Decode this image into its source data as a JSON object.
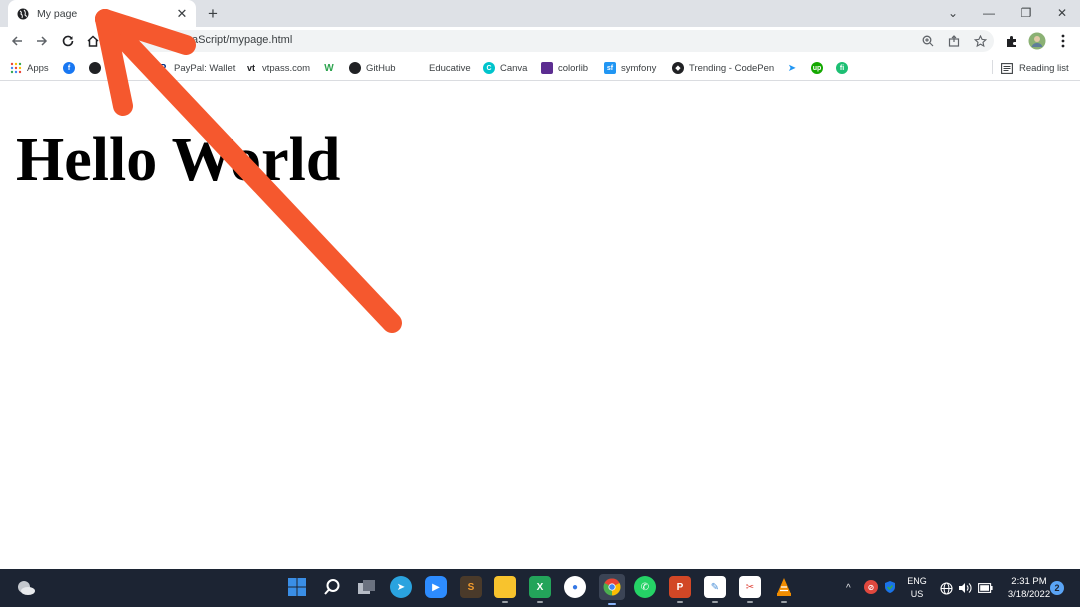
{
  "tab": {
    "title": "My page",
    "close_glyph": "✕",
    "new_tab_glyph": "+"
  },
  "window_controls": {
    "dropdown": "⌄",
    "minimize": "—",
    "restore": "❐",
    "close": "✕"
  },
  "address_bar": {
    "url": "aScript/mypage.html"
  },
  "bookmarks": [
    {
      "label": "Apps",
      "color": "#ea4335"
    },
    {
      "label": "",
      "color": "#1877f2"
    },
    {
      "label": "",
      "color": "#202124"
    },
    {
      "label": "PayPal: Wallet",
      "color": "#003087"
    },
    {
      "label": "vtpass.com",
      "color": "#202124"
    },
    {
      "label": "",
      "color": "#2ea44f"
    },
    {
      "label": "GitHub",
      "color": "#202124"
    },
    {
      "label": "Educative",
      "color": "#ffffff"
    },
    {
      "label": "Canva",
      "color": "#00c4cc"
    },
    {
      "label": "colorlib",
      "color": "#5c2d91"
    },
    {
      "label": "symfony",
      "color": "#2196f3"
    },
    {
      "label": "Trending - CodePen",
      "color": "#202124"
    },
    {
      "label": "",
      "color": "#2196f3"
    },
    {
      "label": "",
      "color": "#14a800"
    },
    {
      "label": "",
      "color": "#1dbf73"
    }
  ],
  "reading_list": {
    "label": "Reading list"
  },
  "page": {
    "heading": "Hello World"
  },
  "annotation": {
    "arrow_color": "#f5582e"
  },
  "taskbar": {
    "apps": [
      {
        "name": "start",
        "color": "#3a8ee6"
      },
      {
        "name": "search",
        "color": "#1c2433"
      },
      {
        "name": "task-view",
        "color": "#8a8f98"
      },
      {
        "name": "telegram",
        "color": "#2aa3df"
      },
      {
        "name": "zoom",
        "color": "#2d8cff"
      },
      {
        "name": "sublime",
        "color": "#f29b2d"
      },
      {
        "name": "file-explorer",
        "color": "#f8c32d"
      },
      {
        "name": "vscode",
        "color": "#23a45a"
      },
      {
        "name": "app-blue",
        "color": "#3578e5"
      },
      {
        "name": "chrome",
        "color": "#4caf50"
      },
      {
        "name": "whatsapp",
        "color": "#25d366"
      },
      {
        "name": "powerpoint",
        "color": "#d24726"
      },
      {
        "name": "notepad",
        "color": "#4a90d9"
      },
      {
        "name": "snipping-tool",
        "color": "#e0483e"
      },
      {
        "name": "vlc",
        "color": "#f08c00"
      }
    ],
    "language": {
      "line1": "ENG",
      "line2": "US"
    },
    "clock": {
      "time": "2:31 PM",
      "date": "3/18/2022"
    },
    "notification_count": "2"
  }
}
